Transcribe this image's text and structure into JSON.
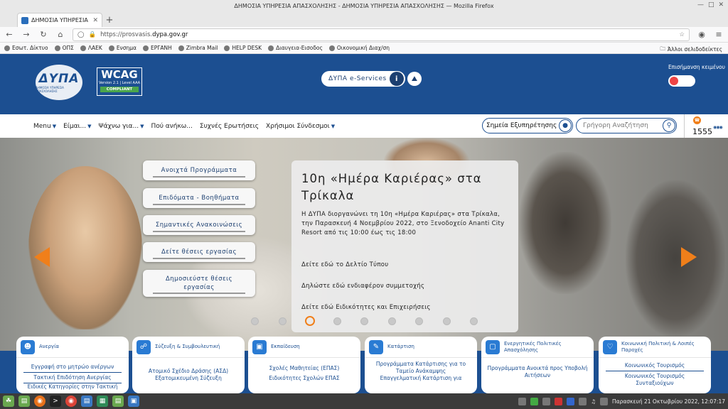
{
  "browser": {
    "window_title": "ΔΗΜΟΣΙΑ ΥΠΗΡΕΣΙΑ ΑΠΑΣΧΟΛΗΣΗΣ - ΔΗΜΟΣΙΑ ΥΠΗΡΕΣΙΑ ΑΠΑΣΧΟΛΗΣΗΣ — Mozilla Firefox",
    "tab_title": "ΔΗΜΟΣΙΑ ΥΠΗΡΕΣΙΑ ΑΠΑΣΧ",
    "new_tab": "+",
    "url_prefix": "https://prosvasis.",
    "url_host": "dypa.gov.gr",
    "bookmarks": [
      "Εσωτ. Δίκτυο",
      "ΟΠΣ",
      "ΛΑΕΚ",
      "Ενσημα",
      "ΕΡΓΑΝΗ",
      "Zimbra Mail",
      "HELP DESK",
      "Διαυγεια-Εισοδος",
      "Οικονομική Διαχ/ση"
    ],
    "other_bookmarks": "Άλλοι σελιδοδείκτες"
  },
  "header": {
    "logo_text": "ΔΥΠΑ",
    "logo_sub": "ΔΗΜΟΣΙΑ ΥΠΗΡΕΣΙΑ ΑΠΑΣΧΟΛΗΣΗΣ",
    "wcag_title": "WCAG",
    "wcag_version": "Version 2.1 | Level AAA",
    "wcag_compliant": "COMPLIANT",
    "eservices_label": "ΔΥΠΑ e-Services",
    "eservices_info": "i",
    "sign_language": "Επισήμανση κειμένου",
    "toggle_state": "off"
  },
  "menubar": {
    "items": [
      {
        "label": "Menu",
        "dropdown": true
      },
      {
        "label": "Είμαι...",
        "dropdown": true
      },
      {
        "label": "Ψάχνω για...",
        "dropdown": true
      },
      {
        "label": "Πού ανήκω...",
        "dropdown": false
      },
      {
        "label": "Συχνές Ερωτήσεις",
        "dropdown": false
      },
      {
        "label": "Χρήσιμοι Σύνδεσμοι",
        "dropdown": true
      }
    ],
    "service_points": "Σημεία Εξυπηρέτησης",
    "search_placeholder": "Γρήγορη Αναζήτηση",
    "phone_number": "1555"
  },
  "hero": {
    "quick_buttons": [
      "Ανοιχτά Προγράμματα",
      "Επιδόματα - Βοηθήματα",
      "Σημαντικές Ανακοινώσεις",
      "Δείτε θέσεις εργασίας",
      "Δημοσιεύστε θέσεις εργασίας"
    ],
    "news_title": "10η «Ημέρα Καριέρας» στα Τρίκαλα",
    "news_body": "Η ΔΥΠΑ διοργανώνει τη 10η «Ημέρα Καριέρας» στα Τρίκαλα, την Παρασκευή 4 Νοεμβρίου 2022, στο Ξενοδοχείο Ananti City Resort από τις 10:00 έως τις 18:00",
    "links": [
      "Δείτε εδώ το Δελτίο Τύπου",
      "Δηλώστε εδώ ενδιαφέρον συμμετοχής",
      "Δείτε εδώ Ειδικότητες και Επιχειρήσεις"
    ],
    "slide_count": 9,
    "active_slide": 3
  },
  "cards": [
    {
      "title": "Ανεργία",
      "links": [
        "Εγγραφή στο μητρώο ανέργων",
        "Τακτική Επιδότηση Ανεργίας",
        "Ειδικές Κατηγορίες στην Τακτική"
      ]
    },
    {
      "title": "Σύζευξη & Συμβουλευτική",
      "links": [
        "Ατομικό Σχέδιο Δράσης (ΑΣΔ)",
        "Εξατομικευμένη Σύζευξη"
      ]
    },
    {
      "title": "Εκπαίδευση",
      "links": [
        "Σχολές Μαθητείας (ΕΠΑΣ)",
        "Ειδικότητες Σχολών ΕΠΑΣ"
      ]
    },
    {
      "title": "Κατάρτιση",
      "links": [
        "Προγράμματα Κατάρτισης για το Ταμείο Ανάκαμψης",
        "Επαγγελματική Κατάρτιση για"
      ]
    },
    {
      "title": "Ενεργητικές Πολιτικές Απασχόλησης",
      "links": [
        "Προγράμματα Ανοικτά προς Υποβολή Αιτήσεων"
      ]
    },
    {
      "title": "Κοινωνική Πολιτική & Λοιπές Παροχές",
      "links": [
        "Κοινωνικός Τουρισμός",
        "Κοινωνικός Τουρισμός Συνταξιούχων"
      ]
    }
  ],
  "taskbar": {
    "clock": "Παρασκευή 21 Οκτωβρίου 2022, 12:07:17"
  }
}
